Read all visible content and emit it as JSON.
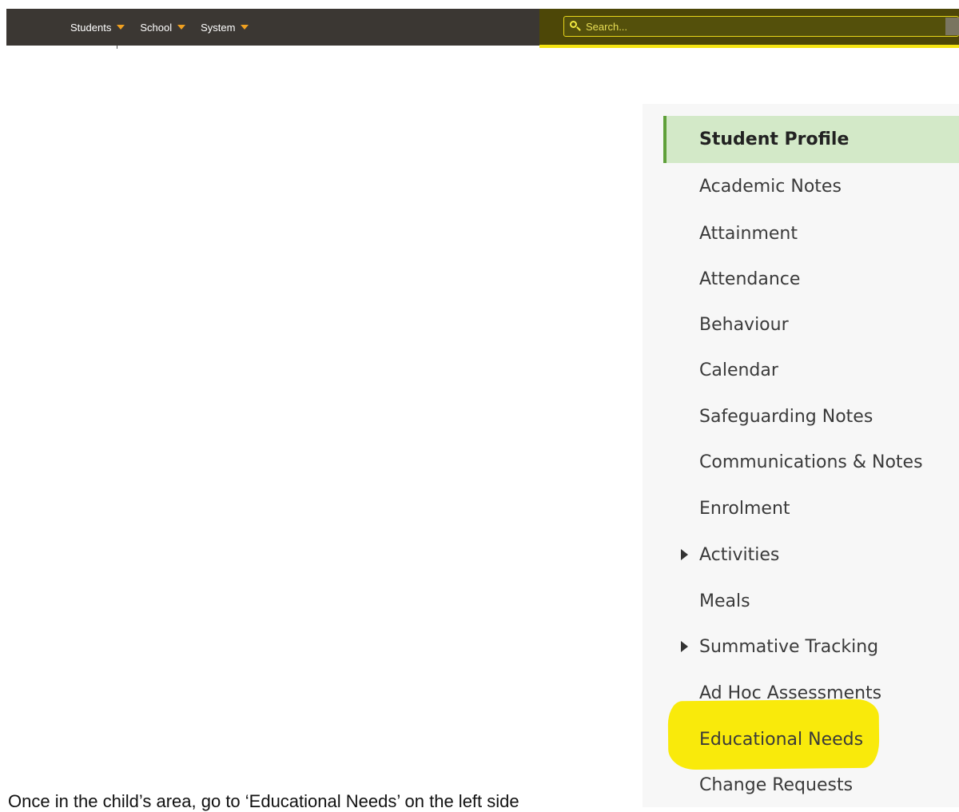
{
  "topnav": {
    "items": [
      {
        "label": "Students"
      },
      {
        "label": "School"
      },
      {
        "label": "System"
      }
    ],
    "search": {
      "placeholder": "Search..."
    }
  },
  "sidebar": {
    "items": [
      {
        "label": "Student Profile",
        "active": true
      },
      {
        "label": "Academic Notes"
      },
      {
        "label": "Attainment"
      },
      {
        "label": "Attendance"
      },
      {
        "label": "Behaviour"
      },
      {
        "label": "Calendar"
      },
      {
        "label": "Safeguarding Notes"
      },
      {
        "label": "Communications & Notes"
      },
      {
        "label": "Enrolment"
      },
      {
        "label": "Activities",
        "expandable": true
      },
      {
        "label": "Meals"
      },
      {
        "label": "Summative Tracking",
        "expandable": true
      },
      {
        "label": "Ad Hoc Assessments"
      },
      {
        "label": "Educational Needs",
        "highlighted": true
      },
      {
        "label": "Change Requests"
      }
    ]
  },
  "caption": "Once in the child’s area, go to ‘Educational Needs’ on the left side",
  "colors": {
    "topbar": "#3b3733",
    "highlight": "#f9ea0b",
    "active_item_bg": "#d3e9c8",
    "active_item_border": "#5fa03a",
    "caret": "#f0a020"
  }
}
